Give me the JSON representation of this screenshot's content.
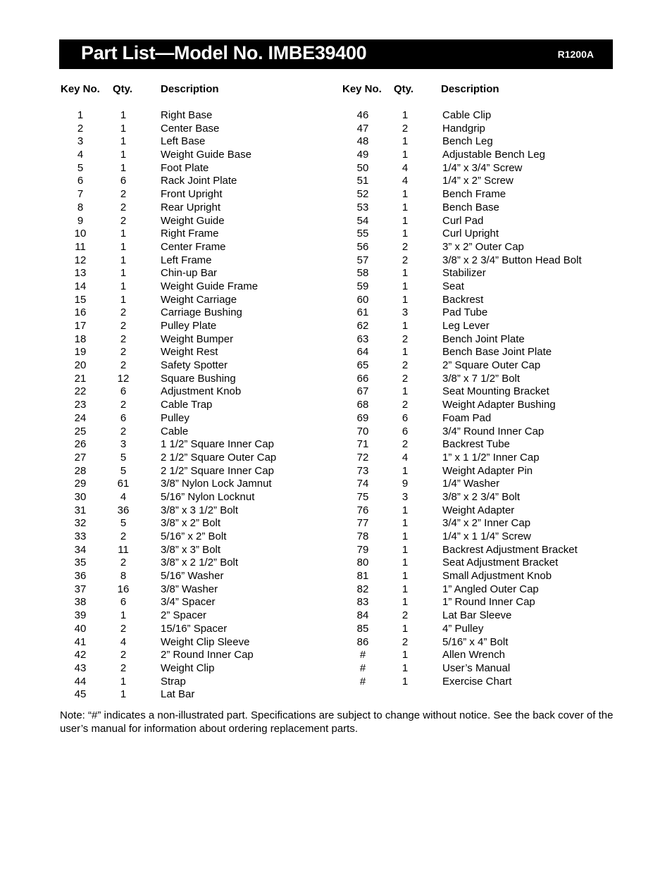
{
  "header": {
    "title": "Part List—Model No. IMBE39400",
    "code": "R1200A"
  },
  "columns": {
    "key": "Key No.",
    "qty": "Qty.",
    "description": "Description"
  },
  "parts_left": [
    {
      "key": "1",
      "qty": "1",
      "desc": "Right Base"
    },
    {
      "key": "2",
      "qty": "1",
      "desc": "Center Base"
    },
    {
      "key": "3",
      "qty": "1",
      "desc": "Left Base"
    },
    {
      "key": "4",
      "qty": "1",
      "desc": "Weight Guide Base"
    },
    {
      "key": "5",
      "qty": "1",
      "desc": "Foot Plate"
    },
    {
      "key": "6",
      "qty": "6",
      "desc": "Rack Joint Plate"
    },
    {
      "key": "7",
      "qty": "2",
      "desc": "Front Upright"
    },
    {
      "key": "8",
      "qty": "2",
      "desc": "Rear Upright"
    },
    {
      "key": "9",
      "qty": "2",
      "desc": "Weight Guide"
    },
    {
      "key": "10",
      "qty": "1",
      "desc": "Right Frame"
    },
    {
      "key": "11",
      "qty": "1",
      "desc": "Center Frame"
    },
    {
      "key": "12",
      "qty": "1",
      "desc": "Left Frame"
    },
    {
      "key": "13",
      "qty": "1",
      "desc": "Chin-up Bar"
    },
    {
      "key": "14",
      "qty": "1",
      "desc": "Weight Guide Frame"
    },
    {
      "key": "15",
      "qty": "1",
      "desc": "Weight Carriage"
    },
    {
      "key": "16",
      "qty": "2",
      "desc": "Carriage Bushing"
    },
    {
      "key": "17",
      "qty": "2",
      "desc": "Pulley Plate"
    },
    {
      "key": "18",
      "qty": "2",
      "desc": "Weight Bumper"
    },
    {
      "key": "19",
      "qty": "2",
      "desc": "Weight Rest"
    },
    {
      "key": "20",
      "qty": "2",
      "desc": "Safety Spotter"
    },
    {
      "key": "21",
      "qty": "12",
      "desc": "Square Bushing"
    },
    {
      "key": "22",
      "qty": "6",
      "desc": "Adjustment Knob"
    },
    {
      "key": "23",
      "qty": "2",
      "desc": "Cable Trap"
    },
    {
      "key": "24",
      "qty": "6",
      "desc": "Pulley"
    },
    {
      "key": "25",
      "qty": "2",
      "desc": "Cable"
    },
    {
      "key": "26",
      "qty": "3",
      "desc": "1 1/2” Square Inner Cap"
    },
    {
      "key": "27",
      "qty": "5",
      "desc": "2 1/2” Square Outer Cap"
    },
    {
      "key": "28",
      "qty": "5",
      "desc": "2 1/2” Square Inner Cap"
    },
    {
      "key": "29",
      "qty": "61",
      "desc": "3/8” Nylon Lock Jamnut"
    },
    {
      "key": "30",
      "qty": "4",
      "desc": "5/16” Nylon Locknut"
    },
    {
      "key": "31",
      "qty": "36",
      "desc": "3/8” x 3 1/2” Bolt"
    },
    {
      "key": "32",
      "qty": "5",
      "desc": "3/8” x 2” Bolt"
    },
    {
      "key": "33",
      "qty": "2",
      "desc": "5/16” x 2” Bolt"
    },
    {
      "key": "34",
      "qty": "11",
      "desc": "3/8” x 3” Bolt"
    },
    {
      "key": "35",
      "qty": "2",
      "desc": "3/8” x 2 1/2” Bolt"
    },
    {
      "key": "36",
      "qty": "8",
      "desc": "5/16” Washer"
    },
    {
      "key": "37",
      "qty": "16",
      "desc": "3/8” Washer"
    },
    {
      "key": "38",
      "qty": "6",
      "desc": "3/4” Spacer"
    },
    {
      "key": "39",
      "qty": "1",
      "desc": "2” Spacer"
    },
    {
      "key": "40",
      "qty": "2",
      "desc": "15/16” Spacer"
    },
    {
      "key": "41",
      "qty": "4",
      "desc": "Weight Clip Sleeve"
    },
    {
      "key": "42",
      "qty": "2",
      "desc": "2” Round Inner Cap"
    },
    {
      "key": "43",
      "qty": "2",
      "desc": "Weight Clip"
    },
    {
      "key": "44",
      "qty": "1",
      "desc": "Strap"
    },
    {
      "key": "45",
      "qty": "1",
      "desc": "Lat Bar"
    }
  ],
  "parts_right": [
    {
      "key": "46",
      "qty": "1",
      "desc": "Cable Clip"
    },
    {
      "key": "47",
      "qty": "2",
      "desc": "Handgrip"
    },
    {
      "key": "48",
      "qty": "1",
      "desc": "Bench Leg"
    },
    {
      "key": "49",
      "qty": "1",
      "desc": "Adjustable Bench Leg"
    },
    {
      "key": "50",
      "qty": "4",
      "desc": "1/4” x 3/4” Screw"
    },
    {
      "key": "51",
      "qty": "4",
      "desc": "1/4” x 2” Screw"
    },
    {
      "key": "52",
      "qty": "1",
      "desc": "Bench Frame"
    },
    {
      "key": "53",
      "qty": "1",
      "desc": "Bench Base"
    },
    {
      "key": "54",
      "qty": "1",
      "desc": "Curl Pad"
    },
    {
      "key": "55",
      "qty": "1",
      "desc": "Curl Upright"
    },
    {
      "key": "56",
      "qty": "2",
      "desc": "3” x 2” Outer Cap"
    },
    {
      "key": "57",
      "qty": "2",
      "desc": "3/8” x 2 3/4” Button Head Bolt"
    },
    {
      "key": "58",
      "qty": "1",
      "desc": "Stabilizer"
    },
    {
      "key": "59",
      "qty": "1",
      "desc": "Seat"
    },
    {
      "key": "60",
      "qty": "1",
      "desc": "Backrest"
    },
    {
      "key": "61",
      "qty": "3",
      "desc": "Pad Tube"
    },
    {
      "key": "62",
      "qty": "1",
      "desc": "Leg Lever"
    },
    {
      "key": "63",
      "qty": "2",
      "desc": "Bench Joint Plate"
    },
    {
      "key": "64",
      "qty": "1",
      "desc": "Bench Base Joint Plate"
    },
    {
      "key": "65",
      "qty": "2",
      "desc": "2” Square Outer Cap"
    },
    {
      "key": "66",
      "qty": "2",
      "desc": "3/8” x 7 1/2” Bolt"
    },
    {
      "key": "67",
      "qty": "1",
      "desc": "Seat Mounting Bracket"
    },
    {
      "key": "68",
      "qty": "2",
      "desc": "Weight Adapter Bushing"
    },
    {
      "key": "69",
      "qty": "6",
      "desc": "Foam Pad"
    },
    {
      "key": "70",
      "qty": "6",
      "desc": "3/4” Round Inner Cap"
    },
    {
      "key": "71",
      "qty": "2",
      "desc": "Backrest Tube"
    },
    {
      "key": "72",
      "qty": "4",
      "desc": "1” x 1 1/2” Inner Cap"
    },
    {
      "key": "73",
      "qty": "1",
      "desc": "Weight Adapter Pin"
    },
    {
      "key": "74",
      "qty": "9",
      "desc": "1/4” Washer"
    },
    {
      "key": "75",
      "qty": "3",
      "desc": "3/8” x 2 3/4” Bolt"
    },
    {
      "key": "76",
      "qty": "1",
      "desc": "Weight Adapter"
    },
    {
      "key": "77",
      "qty": "1",
      "desc": "3/4” x 2” Inner Cap"
    },
    {
      "key": "78",
      "qty": "1",
      "desc": "1/4” x 1 1/4” Screw"
    },
    {
      "key": "79",
      "qty": "1",
      "desc": "Backrest Adjustment Bracket"
    },
    {
      "key": "80",
      "qty": "1",
      "desc": "Seat Adjustment Bracket"
    },
    {
      "key": "81",
      "qty": "1",
      "desc": "Small Adjustment Knob"
    },
    {
      "key": "82",
      "qty": "1",
      "desc": "1” Angled Outer Cap"
    },
    {
      "key": "83",
      "qty": "1",
      "desc": "1” Round Inner Cap"
    },
    {
      "key": "84",
      "qty": "2",
      "desc": "Lat Bar Sleeve"
    },
    {
      "key": "85",
      "qty": "1",
      "desc": "4” Pulley"
    },
    {
      "key": "86",
      "qty": "2",
      "desc": "5/16” x 4” Bolt"
    },
    {
      "key": "#",
      "qty": "1",
      "desc": "Allen Wrench"
    },
    {
      "key": "#",
      "qty": "1",
      "desc": "User’s Manual"
    },
    {
      "key": "#",
      "qty": "1",
      "desc": "Exercise Chart"
    }
  ],
  "note": "Note: “#” indicates a non-illustrated part. Specifications are subject to change without notice. See the back cover of the user’s manual for information about ordering replacement parts."
}
